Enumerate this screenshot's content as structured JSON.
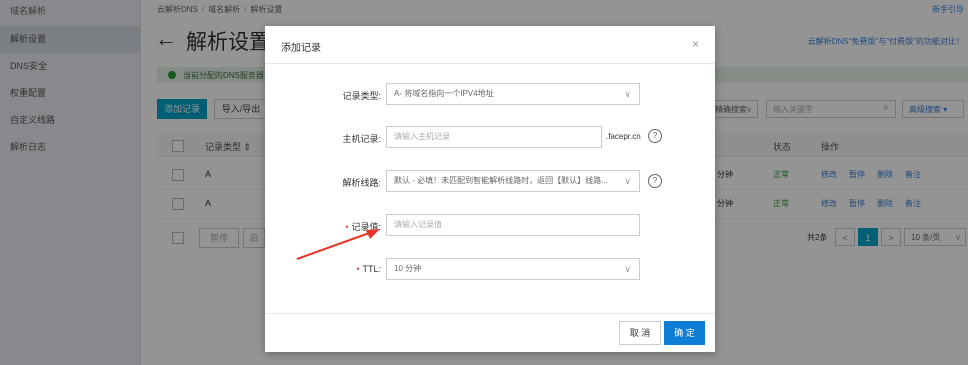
{
  "sidebar": {
    "title": "域名解析",
    "items": [
      {
        "label": "解析设置",
        "active": true
      },
      {
        "label": "DNS安全"
      },
      {
        "label": "权重配置"
      },
      {
        "label": "自定义线路"
      },
      {
        "label": "解析日志"
      }
    ]
  },
  "header": {
    "breadcrumb": [
      "云解析DNS",
      "域名解析",
      "解析设置"
    ],
    "help_link": "新手引导",
    "page_title": "解析设置",
    "promo_link": "云解析DNS\"免费版\"与\"付费版\"的功能对比！"
  },
  "notice": {
    "text": "当前分配的DNS服务器"
  },
  "toolbar": {
    "add_record": "添加记录",
    "import_export": "导入/导出",
    "search_mode": "精确搜索",
    "search_placeholder": "输入关键字",
    "advanced_search": "高级搜索"
  },
  "table": {
    "columns": {
      "record_type": "记录类型",
      "status": "状态",
      "actions": "操作"
    },
    "rows": [
      {
        "type": "A",
        "ttl": "分钟",
        "status": "正常",
        "ops": [
          "修改",
          "暂停",
          "删除",
          "备注"
        ]
      },
      {
        "type": "A",
        "ttl": "分钟",
        "status": "正常",
        "ops": [
          "修改",
          "暂停",
          "删除",
          "备注"
        ]
      }
    ],
    "batch_pause": "暂停",
    "batch_enable": "启"
  },
  "pagination": {
    "total": "共2条",
    "prev": "<",
    "current_page": "1",
    "next": ">",
    "page_size": "10 条/页"
  },
  "modal": {
    "title": "添加记录",
    "close": "×",
    "record_type": {
      "label": "记录类型:",
      "value": "A- 将域名指向一个IPV4地址"
    },
    "host": {
      "label": "主机记录:",
      "placeholder": "请输入主机记录",
      "suffix": ".facepr.cn"
    },
    "line": {
      "label": "解析线路:",
      "value": "默认 - 必填！未匹配到智能解析线路时，返回【默认】线路..."
    },
    "value": {
      "label": "记录值:",
      "placeholder": "请输入记录值"
    },
    "ttl": {
      "label": "TTL:",
      "value": "10 分钟"
    },
    "cancel": "取 消",
    "confirm": "确 定"
  },
  "annotation": {
    "arrow_color": "#e8332a"
  }
}
